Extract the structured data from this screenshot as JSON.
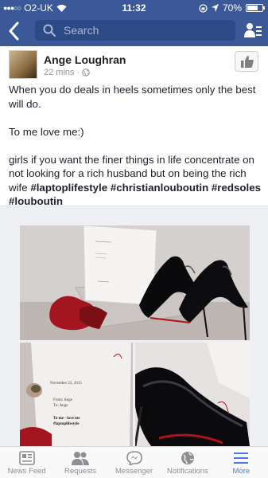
{
  "status_bar": {
    "carrier": "O2-UK",
    "time": "11:32",
    "battery": "70%",
    "battery_level": 0.7
  },
  "nav": {
    "search_placeholder": "Search",
    "icons": [
      "back-chevron-icon",
      "search-icon",
      "friends-list-icon"
    ]
  },
  "post": {
    "author": "Ange Loughran",
    "time_ago": "22 mins",
    "separator": "·",
    "text_1": "When you do deals in heels sometimes only the best will do.",
    "text_2": "To me love me:)",
    "text_3": "girls if you want the finer things in life concentrate on not looking for a rich husband but on being the rich wife ",
    "hashtags": "#laptoplifestyle #christianlouboutin #redsoles #louboutin"
  },
  "photos": {
    "card_lines": [
      "November 23, 2015",
      "From: Ange",
      "To: Ange",
      "To me - love me",
      "#laptoplifestyle"
    ]
  },
  "tabbar": {
    "tabs": [
      {
        "label": "News Feed",
        "icon": "news-feed-icon"
      },
      {
        "label": "Requests",
        "icon": "requests-icon"
      },
      {
        "label": "Messenger",
        "icon": "messenger-icon"
      },
      {
        "label": "Notifications",
        "icon": "globe-icon"
      },
      {
        "label": "More",
        "icon": "menu-icon"
      }
    ],
    "active": "More"
  },
  "colors": {
    "brand": "#3b5998",
    "active_tab": "#4a7ae0"
  }
}
